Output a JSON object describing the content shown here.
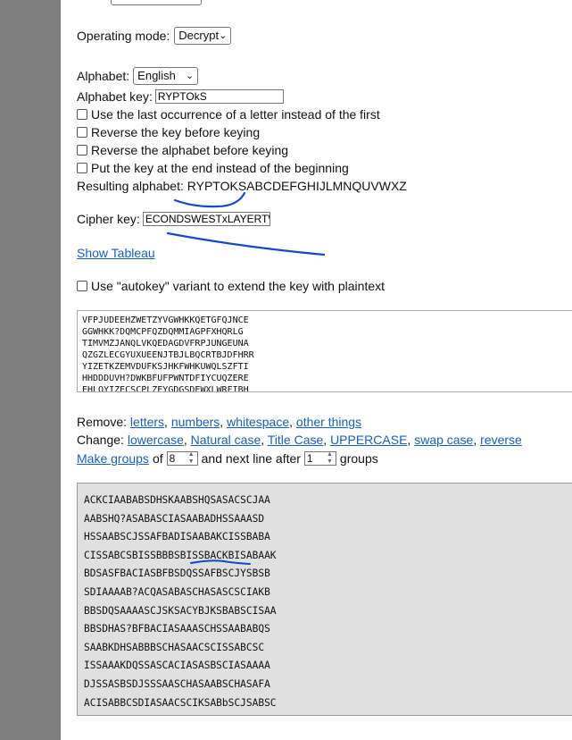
{
  "operating_mode": {
    "label": "Operating mode:",
    "value": "Decrypt"
  },
  "alphabet": {
    "label": "Alphabet:",
    "value": "English"
  },
  "alphabet_key": {
    "label": "Alphabet key:",
    "value": "RYPTOkS"
  },
  "options": [
    {
      "label": "Use the last occurrence of a letter instead of the first",
      "checked": false
    },
    {
      "label": "Reverse the key before keying",
      "checked": false
    },
    {
      "label": "Reverse the alphabet before keying",
      "checked": false
    },
    {
      "label": "Put the key at the end instead of the beginning",
      "checked": false
    }
  ],
  "resulting_alphabet": {
    "label": "Resulting alphabet:",
    "value": "RYPTOKSABCDEFGHIJLMNQUVWXZ"
  },
  "cipher_key": {
    "label": "Cipher key:",
    "value": "ECONDSWESTxLAYERTWO"
  },
  "show_tableau": "Show Tableau",
  "autokey": {
    "label": "Use \"autokey\" variant to extend the key with plaintext",
    "checked": false
  },
  "input_lines": [
    "VFPJUDEEHZWETZYVGWHKKQETGFQJNCE",
    "GGWHKK?DQMCPFQZDQMMIAGPFXHQRLG",
    "TIMVMZJANQLVKQEDAGDVFRPJUNGEUNA",
    "QZGZLECGYUXUEENJTBJLBQCRTBJDFHRR",
    "YIZETKZEMVDUFKSJHKFWHKUWQLSZFTI",
    "HHDDDUVH?DWKBFUFPWNTDFIYCUQZERE",
    "EHLQYIZECSCPLZEYGDGSDEWXLWRFIBH"
  ],
  "remove": {
    "label": "Remove:",
    "links": [
      "letters",
      "numbers",
      "whitespace",
      "other things"
    ]
  },
  "change": {
    "label": "Change:",
    "links": [
      "lowercase",
      "Natural case",
      "Title Case",
      "UPPERCASE",
      "swap case",
      "reverse"
    ]
  },
  "groups": {
    "link": "Make groups",
    "of_label": "of",
    "group_size": "8",
    "next_line_label": "and next line after",
    "line_groups": "1",
    "groups_label": "groups"
  },
  "output_lines": [
    "ACKCIAABABSDHSKAABSHQSASACSCJAA",
    "AABSHQ?ASABASCIASAABADHSSAAASD",
    "HSSAABSCJSSAFBADISAABAKCISSBABA",
    "CISSABCSBISSBBBSBISSBACKBISABAAK",
    "BDSASFBACIASBFBSDQSSAFBSCJYSBSB",
    "SDIAAAAB?ACQASABASCHASASCSCIAKB",
    "BBSDQSAAAASCJSKSACYBJKSBABSCISAA",
    "BBSDHAS?BFBACIASAAASCHSSAABABQS",
    "SAABKDHSABBBSCHASAACSCISSABCSC",
    "ISSAAAKDQSSASCACIASASBSCIASAAAA",
    "DJSSASBSDJSSSAASCHASAABSCHASAFA",
    "ACISABBCSDIASAACSCIKSABbSCJSABSC"
  ],
  "colors": {
    "link": "#1a5fb4",
    "annotation": "#1547c9",
    "output_bg": "#e0e0e0",
    "side_bg": "#7f7f7f"
  }
}
